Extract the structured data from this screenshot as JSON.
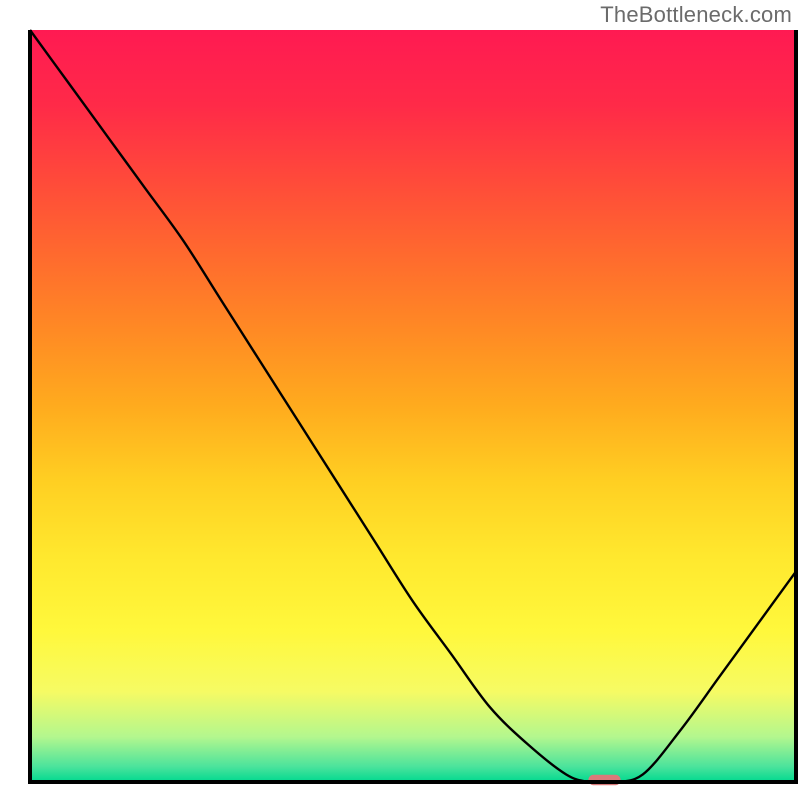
{
  "watermark": "TheBottleneck.com",
  "chart_data": {
    "type": "line",
    "title": "",
    "xlabel": "",
    "ylabel": "",
    "xlim": [
      0,
      100
    ],
    "ylim": [
      0,
      100
    ],
    "x": [
      0,
      5,
      10,
      15,
      20,
      25,
      30,
      35,
      40,
      45,
      50,
      55,
      60,
      65,
      70,
      73,
      76,
      80,
      85,
      90,
      95,
      100
    ],
    "values": [
      100,
      93,
      86,
      79,
      72,
      64,
      56,
      48,
      40,
      32,
      24,
      17,
      10,
      5,
      1,
      0,
      0,
      1,
      7,
      14,
      21,
      28
    ],
    "marker": {
      "x": 75,
      "y": 0,
      "color": "#d97a7a",
      "width": 4.2,
      "height": 1.4
    },
    "gradient_bands": [
      {
        "y": 100,
        "color": "#ff1a52"
      },
      {
        "y": 90,
        "color": "#ff2a48"
      },
      {
        "y": 80,
        "color": "#ff4a3a"
      },
      {
        "y": 70,
        "color": "#ff6a2e"
      },
      {
        "y": 60,
        "color": "#ff8a24"
      },
      {
        "y": 50,
        "color": "#ffab1e"
      },
      {
        "y": 40,
        "color": "#ffcf22"
      },
      {
        "y": 30,
        "color": "#ffe82e"
      },
      {
        "y": 20,
        "color": "#fff83c"
      },
      {
        "y": 12,
        "color": "#f6fb64"
      },
      {
        "y": 6,
        "color": "#b3f78e"
      },
      {
        "y": 2,
        "color": "#4ae39c"
      },
      {
        "y": 0,
        "color": "#00d98f"
      }
    ],
    "frame": {
      "color": "#000",
      "stroke": 4
    }
  }
}
